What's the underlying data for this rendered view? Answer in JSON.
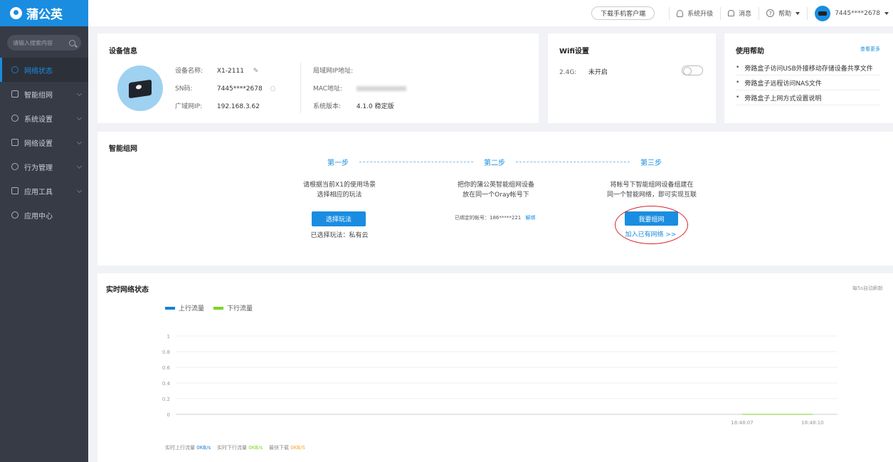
{
  "brand": {
    "name": "蒲公英"
  },
  "sidebar": {
    "search_placeholder": "请输入搜索内容",
    "items": [
      {
        "label": "网络状态"
      },
      {
        "label": "智能组网"
      },
      {
        "label": "系统设置"
      },
      {
        "label": "网络设置"
      },
      {
        "label": "行为管理"
      },
      {
        "label": "应用工具"
      },
      {
        "label": "应用中心"
      }
    ]
  },
  "topbar": {
    "download": "下载手机客户端",
    "upgrade": "系统升级",
    "messages": "消息",
    "help": "帮助",
    "help_icon": "?",
    "user": "7445****2678"
  },
  "device": {
    "title": "设备信息",
    "name_label": "设备名称:",
    "name_value": "X1-2111",
    "sn_label": "SN码:",
    "sn_value": "7445****2678",
    "wan_label": "广域网IP:",
    "wan_value": "192.168.3.62",
    "lan_label": "局域网IP地址:",
    "lan_value": "",
    "mac_label": "MAC地址:",
    "version_label": "系统版本:",
    "version_value": "4.1.0 稳定版"
  },
  "wifi": {
    "title": "Wifi设置",
    "band_label": "2.4G:",
    "band_value": "未开启"
  },
  "help": {
    "title": "使用帮助",
    "more": "查看更多",
    "items": [
      "旁路盒子访问USB外接移动存储设备共享文件",
      "旁路盒子远程访问NAS文件",
      "旁路盒子上网方式设置说明"
    ]
  },
  "smart": {
    "title": "智能组网",
    "step1": "第一步",
    "step2": "第二步",
    "step3": "第三步",
    "step1_desc_1": "请根据当前X1的使用场景",
    "step1_desc_2": "选择相应的玩法",
    "step1_button": "选择玩法",
    "step1_selected": "已选择玩法：私有云",
    "step2_desc_1": "把你的蒲公英智能组网设备",
    "step2_desc_2": "放在同一个Oray帐号下",
    "step2_account": "已绑定的帐号：186*****221",
    "step2_unbind": "解绑",
    "step3_desc_1": "将帐号下智能组网设备组建在",
    "step3_desc_2": "同一个智能网络，即可实现互联",
    "step3_button": "我要组网",
    "step3_join": "加入已有网络 >>"
  },
  "realtime": {
    "title": "实时网络状态",
    "refresh": "每5s自动刷新",
    "legend_up": "上行流量",
    "legend_down": "下行流量",
    "up_color": "#1a7fd4",
    "down_color": "#7ed321",
    "y_ticks": [
      "1",
      "0.8",
      "0.6",
      "0.4",
      "0.2",
      "0"
    ],
    "x_ticks": [
      "18:48:07",
      "18:48:10"
    ],
    "stat_up_label": "实时上行流量",
    "stat_up_value": "0KB/s",
    "stat_down_label": "实时下行流量",
    "stat_down_value": "0KB/s",
    "stat_max_label": "最快下载",
    "stat_max_value": "0KB/S"
  },
  "chart_data": {
    "type": "line",
    "x": [
      "18:48:07",
      "18:48:10"
    ],
    "ylim": [
      0,
      1
    ],
    "grid": true,
    "legend": "top-left",
    "series": [
      {
        "name": "上行流量",
        "values": [
          0,
          0
        ]
      },
      {
        "name": "下行流量",
        "values": [
          0,
          0
        ]
      }
    ]
  }
}
